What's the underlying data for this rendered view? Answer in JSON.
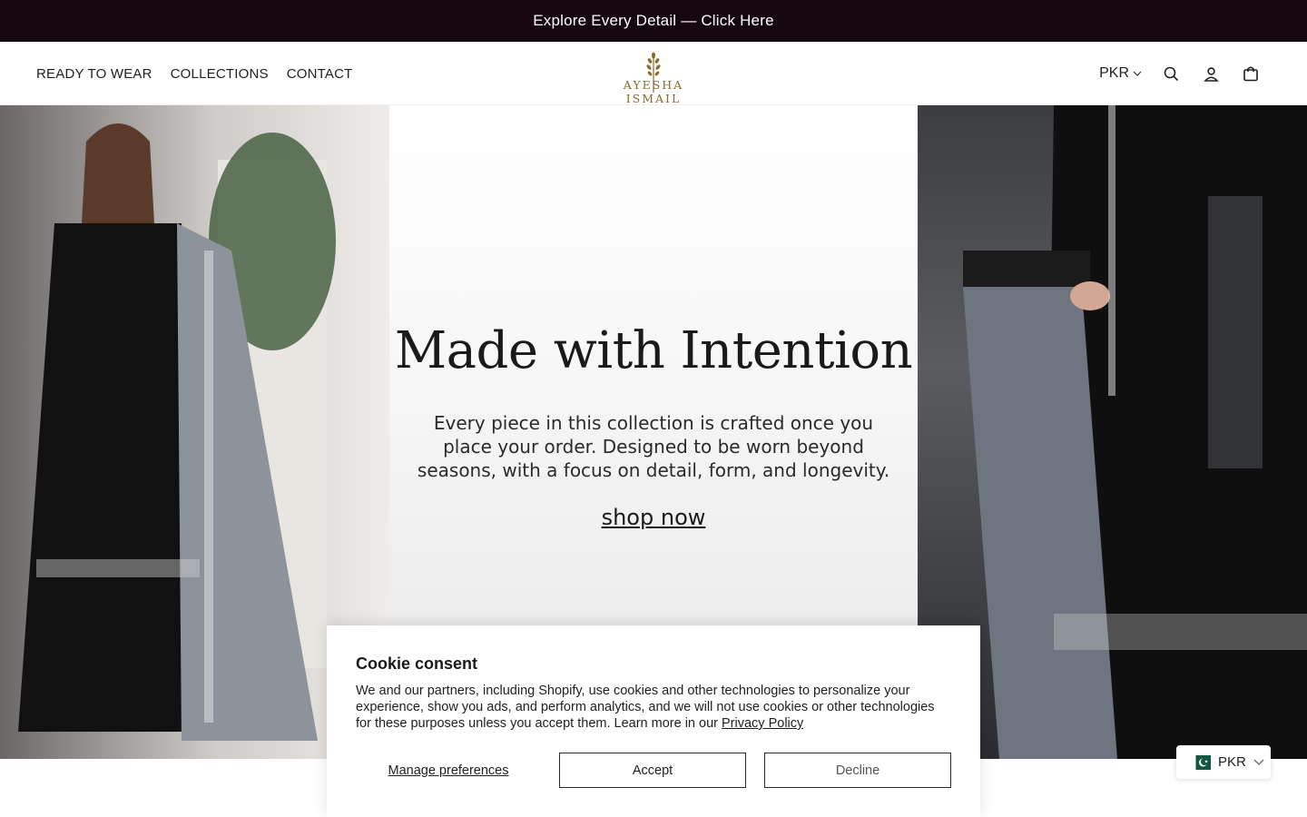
{
  "announcement": {
    "text": "Explore Every Detail — Click Here"
  },
  "nav": {
    "items": [
      {
        "label": "READY TO WEAR"
      },
      {
        "label": "COLLECTIONS"
      },
      {
        "label": "CONTACT"
      }
    ]
  },
  "logo": {
    "text": "AYESHA ISMAIL"
  },
  "header": {
    "currency": "PKR",
    "icons": [
      "search-icon",
      "account-icon",
      "cart-icon"
    ]
  },
  "hero": {
    "title": "Made with Intention",
    "body": "Every piece in this collection is crafted once you place your order. Designed to be worn beyond seasons, with a focus on detail, form, and longevity.",
    "cta": "shop now"
  },
  "cookie": {
    "title": "Cookie consent",
    "text": "We and our partners, including Shopify, use cookies and other technologies to personalize your experience, show you ads, and perform analytics, and we will not use cookies or other technologies for these purposes unless you accept them. Learn more in our",
    "link": "Privacy Policy",
    "manage": "Manage preferences",
    "accept": "Accept",
    "decline": "Decline"
  },
  "currency_widget": {
    "code": "PKR",
    "flag": "pakistan-flag-icon"
  },
  "colors": {
    "announcement_bg": "#16060f",
    "logo_gold": "#8a6a2f"
  }
}
